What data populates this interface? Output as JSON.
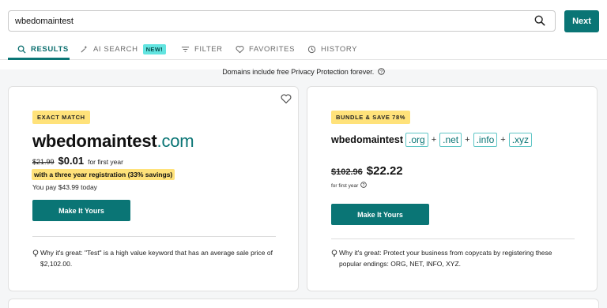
{
  "search": {
    "value": "wbedomaintest",
    "next_label": "Next"
  },
  "tabs": [
    {
      "label": "RESULTS",
      "icon": "search-icon",
      "active": true
    },
    {
      "label": "AI SEARCH",
      "icon": "ai-sparkle-icon",
      "badge": "NEW!"
    },
    {
      "label": "FILTER",
      "icon": "filter-icon"
    },
    {
      "label": "FAVORITES",
      "icon": "heart-icon"
    },
    {
      "label": "HISTORY",
      "icon": "history-icon"
    }
  ],
  "privacy_note": "Domains include free Privacy Protection forever.",
  "exact_match": {
    "tag": "EXACT MATCH",
    "domain_name": "wbedomaintest",
    "domain_tld": ".com",
    "old_price": "$21.99",
    "price": "$0.01",
    "price_note": "for first year",
    "savings": "with a three year registration (33% savings)",
    "you_pay": "You pay $43.99 today",
    "cta": "Make It Yours",
    "why": "Why it's great: \"Test\" is a high value keyword that has an average sale price of $2,102.00."
  },
  "bundle": {
    "tag": "BUNDLE & SAVE 78%",
    "domain_name": "wbedomaintest",
    "tlds": [
      ".org",
      ".net",
      ".info",
      ".xyz"
    ],
    "plus": "+",
    "old_price": "$102.96",
    "price": "$22.22",
    "price_note": "for first year",
    "cta": "Make It Yours",
    "why": "Why it's great: Protect your business from copycats by registering these popular endings: ORG, NET, INFO, XYZ."
  },
  "colors": {
    "accent": "#0a7575",
    "highlight": "#ffe27a",
    "badge": "#62e4e0"
  }
}
